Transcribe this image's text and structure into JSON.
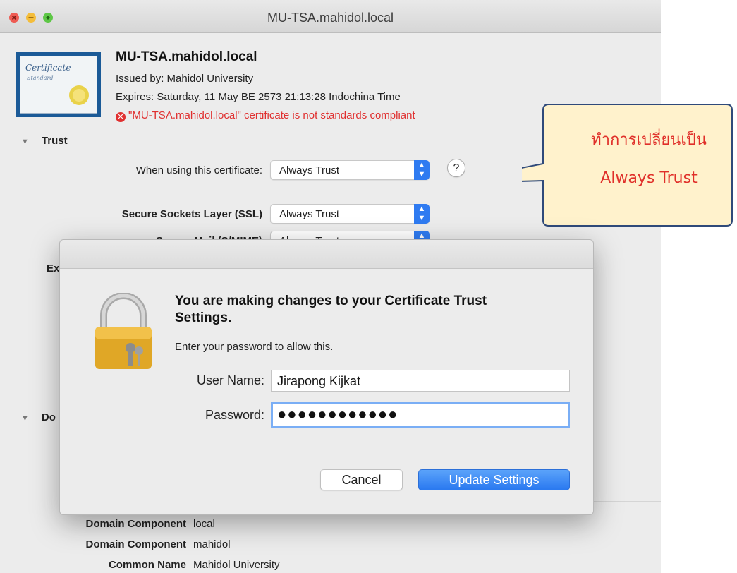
{
  "window": {
    "title": "MU-TSA.mahidol.local"
  },
  "certificate": {
    "name": "MU-TSA.mahidol.local",
    "issued_by": "Issued by: Mahidol University",
    "expires": "Expires: Saturday, 11 May BE 2573 21:13:28 Indochina Time",
    "error": "\"MU-TSA.mahidol.local\" certificate is not standards compliant",
    "image_text_1": "Certificate",
    "image_text_2": "Standard"
  },
  "trust": {
    "section_label": "Trust",
    "when_using_label": "When using this certificate:",
    "when_using_value": "Always Trust",
    "help": "?",
    "ssl_label": "Secure Sockets Layer (SSL)",
    "ssl_value": "Always Trust",
    "smime_label": "Secure Mail (S/MIME)",
    "smime_value": "Always Trust",
    "ex_label": "Ex"
  },
  "details": {
    "section_label": "Do",
    "rows": [
      {
        "label": "Domain Component",
        "value": "local"
      },
      {
        "label": "Domain Component",
        "value": "mahidol"
      },
      {
        "label": "Common Name",
        "value": "Mahidol University"
      }
    ]
  },
  "callout": {
    "line1": "ทำการเปลี่ยนเป็น",
    "line2": "Always Trust",
    "text_color": "#e0302a",
    "fill_color": "#fff2cc",
    "border_color": "#2f4a7a"
  },
  "dialog": {
    "title": "You are making changes to your Certificate Trust Settings.",
    "subtitle": "Enter your password to allow this.",
    "username_label": "User Name:",
    "username_value": "Jirapong Kijkat",
    "password_label": "Password:",
    "password_value": "●●●●●●●●●●●●",
    "cancel_label": "Cancel",
    "update_label": "Update Settings"
  }
}
